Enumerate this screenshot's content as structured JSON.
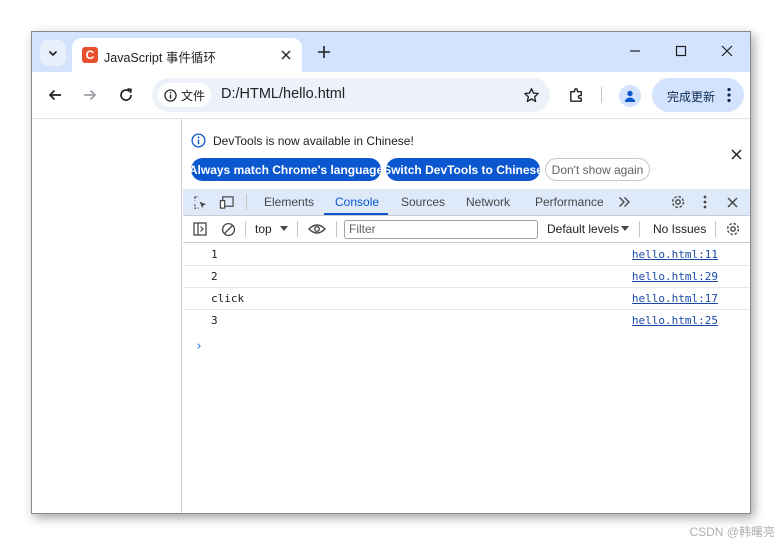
{
  "browser": {
    "tab_title": "JavaScript 事件循环",
    "favicon_letter": "C",
    "url": "D:/HTML/hello.html",
    "site_info_label": "文件",
    "update_button_label": "完成更新"
  },
  "devtools": {
    "infobar": {
      "message": "DevTools is now available in Chinese!",
      "buttons": [
        "Always match Chrome's language",
        "Switch DevTools to Chinese",
        "Don't show again"
      ]
    },
    "tabs": [
      "Elements",
      "Console",
      "Sources",
      "Network",
      "Performance"
    ],
    "active_tab": "Console",
    "filterbar": {
      "context": "top",
      "filter_placeholder": "Filter",
      "levels": "Default levels",
      "issues": "No Issues"
    },
    "console_messages": [
      {
        "text": "1",
        "source": "hello.html:11"
      },
      {
        "text": "2",
        "source": "hello.html:29"
      },
      {
        "text": "click",
        "source": "hello.html:17"
      },
      {
        "text": "3",
        "source": "hello.html:25"
      }
    ],
    "prompt_symbol": "›"
  },
  "watermark": "CSDN @韩曙亮",
  "colors": {
    "tabstrip": "#d3e3fd",
    "accent": "#0b57d0",
    "devtools_toolbar": "#dee9fa"
  }
}
